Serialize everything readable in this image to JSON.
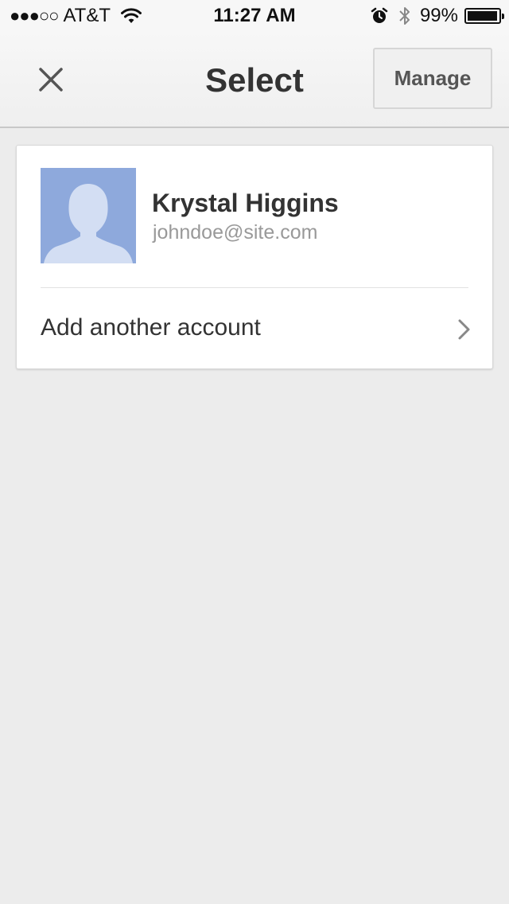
{
  "status_bar": {
    "signal": "●●●○○",
    "carrier": "AT&T",
    "time": "11:27 AM",
    "battery_percent": "99%",
    "icons": [
      "wifi-icon",
      "alarm-icon",
      "bluetooth-icon",
      "battery-icon"
    ]
  },
  "nav": {
    "title": "Select",
    "close_icon": "close-icon",
    "manage_label": "Manage"
  },
  "account": {
    "name": "Krystal Higgins",
    "email": "johndoe@site.com",
    "avatar_icon": "default-avatar-silhouette"
  },
  "add_account": {
    "label": "Add another account",
    "icon": "chevron-right-icon"
  },
  "colors": {
    "background": "#ececec",
    "avatar_bg": "#8ea9dc",
    "avatar_silhouette": "#d3def3",
    "text_primary": "#333333",
    "text_secondary": "#999999"
  }
}
